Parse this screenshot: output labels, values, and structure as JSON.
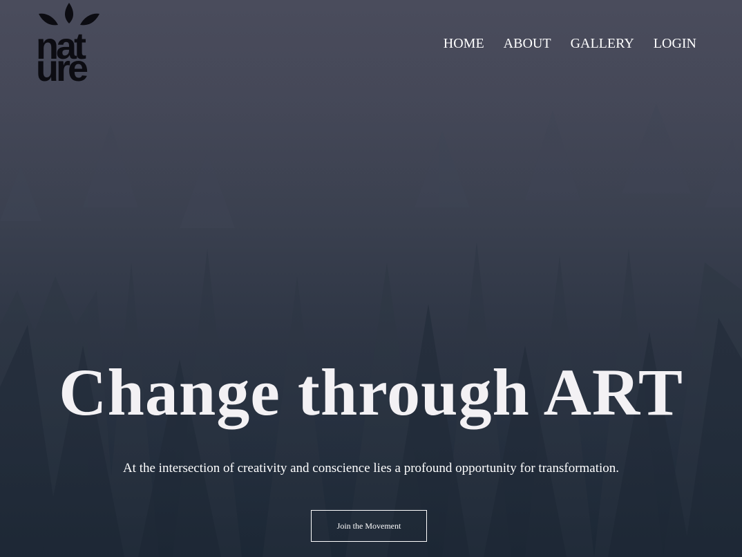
{
  "brand": {
    "logo_line1": "nat",
    "logo_line2": "ure"
  },
  "nav": {
    "items": [
      "HOME",
      "ABOUT",
      "GALLERY",
      "LOGIN"
    ]
  },
  "hero": {
    "headline": "Change through ART",
    "subtitle": "At the intersection of creativity and conscience lies a profound opportunity for transformation.",
    "cta_label": "Join the Movement"
  },
  "colors": {
    "overlay_top": "#4a4c5c",
    "overlay_bottom": "#1e2a38",
    "text": "#ffffff",
    "logo": "#0c0c12"
  }
}
